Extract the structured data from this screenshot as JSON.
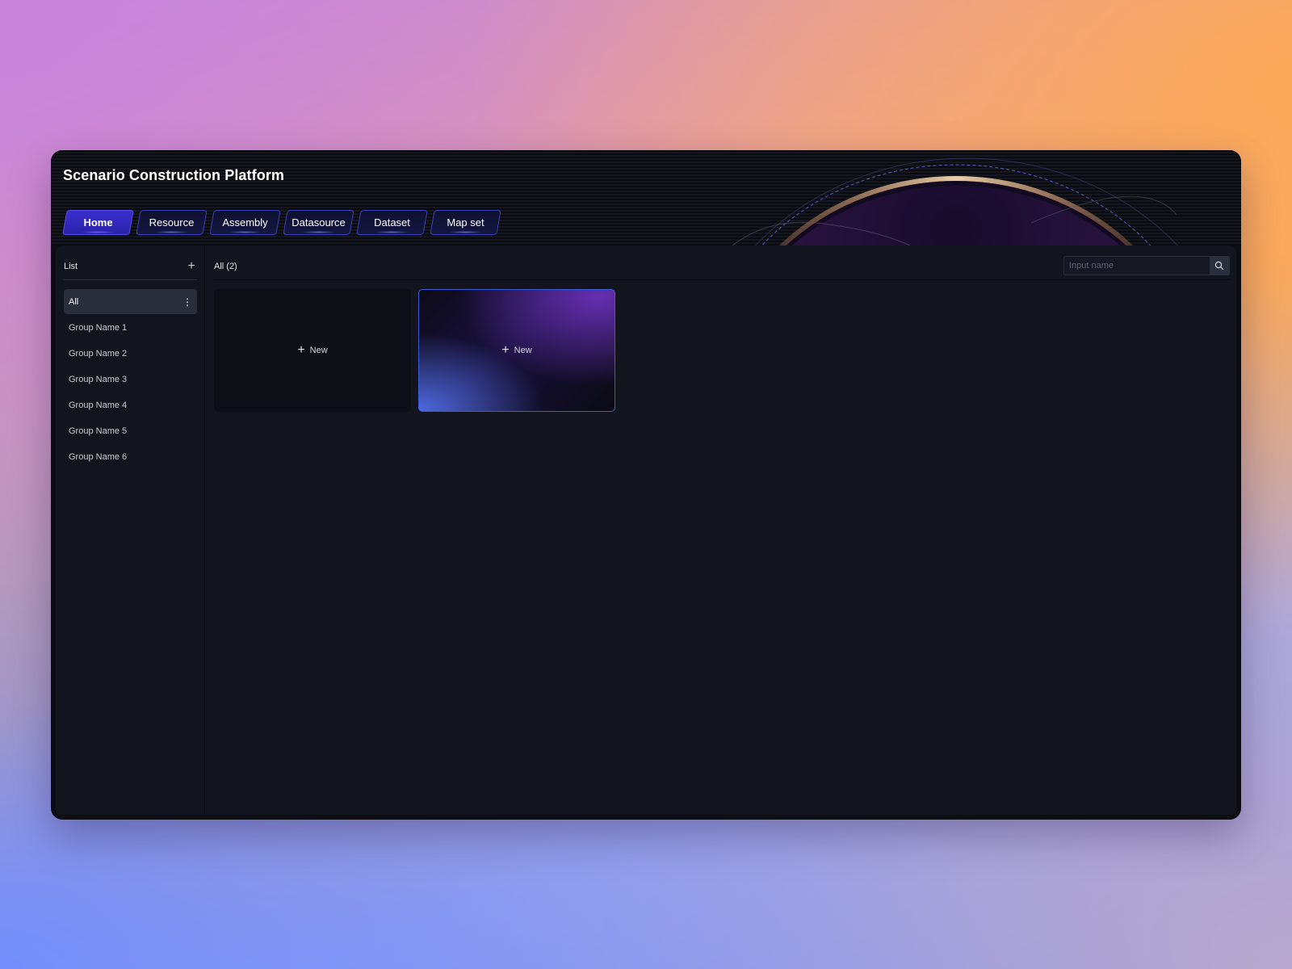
{
  "app": {
    "title": "Scenario Construction Platform"
  },
  "nav": {
    "tabs": [
      {
        "label": "Home",
        "active": true
      },
      {
        "label": "Resource",
        "active": false
      },
      {
        "label": "Assembly",
        "active": false
      },
      {
        "label": "Datasource",
        "active": false
      },
      {
        "label": "Dataset",
        "active": false
      },
      {
        "label": "Map set",
        "active": false
      }
    ]
  },
  "sidebar": {
    "title": "List",
    "add_icon": "plus-icon",
    "groups": [
      {
        "label": "All",
        "active": true
      },
      {
        "label": "Group Name 1"
      },
      {
        "label": "Group Name 2"
      },
      {
        "label": "Group Name 3"
      },
      {
        "label": "Group Name 4"
      },
      {
        "label": "Group Name 5"
      },
      {
        "label": "Group Name 6"
      }
    ],
    "more_icon": "more-vertical-icon"
  },
  "main": {
    "count_label": "All (2)",
    "search": {
      "placeholder": "Input name",
      "value": "",
      "icon": "search-icon"
    },
    "cards": [
      {
        "label": "New",
        "icon": "plus-icon"
      },
      {
        "label": "New",
        "icon": "plus-icon"
      }
    ]
  },
  "colors": {
    "accent": "#3a2ed0",
    "card_border": "#3a5bd6",
    "panel_bg": "#12151d"
  }
}
